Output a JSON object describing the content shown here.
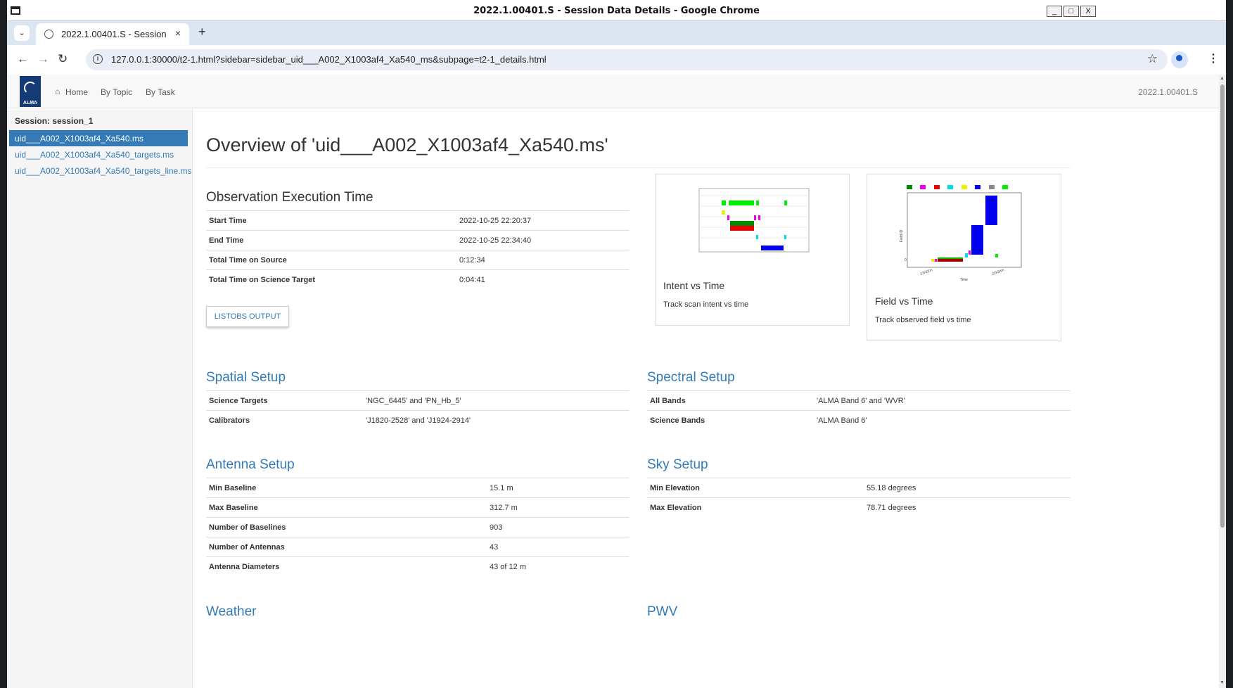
{
  "window": {
    "title": "2022.1.00401.S - Session Data Details - Google Chrome"
  },
  "window_controls": {
    "minimize": "_",
    "maximize": "□",
    "close": "X"
  },
  "tab": {
    "title": "2022.1.00401.S - Session"
  },
  "tabstrip": {
    "new_tab": "+",
    "close_tab": "×",
    "menu": "⌄"
  },
  "toolbar": {
    "url": "127.0.0.1:30000/t2-1.html?sidebar=sidebar_uid___A002_X1003af4_Xa540_ms&subpage=t2-1_details.html",
    "back": "←",
    "forward": "→",
    "reload": "↻",
    "bookmark": "☆",
    "menu": "⋮",
    "info": "i"
  },
  "topnav": {
    "logo_text": "ALMA",
    "home_icon": "⌂",
    "home": "Home",
    "by_topic": "By Topic",
    "by_task": "By Task",
    "project_code": "2022.1.00401.S"
  },
  "sidebar": {
    "header": "Session: session_1",
    "items": [
      {
        "label": "uid___A002_X1003af4_Xa540.ms",
        "active": true
      },
      {
        "label": "uid___A002_X1003af4_Xa540_targets.ms",
        "active": false
      },
      {
        "label": "uid___A002_X1003af4_Xa540_targets_line.ms",
        "active": false
      }
    ]
  },
  "main": {
    "title": "Overview of 'uid___A002_X1003af4_Xa540.ms'",
    "observation": {
      "title": "Observation Execution Time",
      "rows": [
        {
          "key": "Start Time",
          "value": "2022-10-25 22:20:37"
        },
        {
          "key": "End Time",
          "value": "2022-10-25 22:34:40"
        },
        {
          "key": "Total Time on Source",
          "value": "0:12:34"
        },
        {
          "key": "Total Time on Science Target",
          "value": "0:04:41"
        }
      ],
      "button": "LISTOBS OUTPUT"
    },
    "cards": [
      {
        "title": "Intent vs Time",
        "desc": "Track scan intent vs time"
      },
      {
        "title": "Field vs Time",
        "desc": "Track observed field vs time"
      }
    ],
    "plot_labels": {
      "field_ylabel": "Field ID",
      "time_xlabel": "Time",
      "zero": "0",
      "tick_left": "22h22m",
      "tick_right": "22h34m"
    },
    "spatial": {
      "title": "Spatial Setup",
      "rows": [
        {
          "key": "Science Targets",
          "value": "'NGC_6445' and 'PN_Hb_5'"
        },
        {
          "key": "Calibrators",
          "value": "'J1820-2528' and 'J1924-2914'"
        }
      ]
    },
    "spectral": {
      "title": "Spectral Setup",
      "rows": [
        {
          "key": "All Bands",
          "value": "'ALMA Band 6' and 'WVR'"
        },
        {
          "key": "Science Bands",
          "value": "'ALMA Band 6'"
        }
      ]
    },
    "antenna": {
      "title": "Antenna Setup",
      "rows": [
        {
          "key": "Min Baseline",
          "value": "15.1 m"
        },
        {
          "key": "Max Baseline",
          "value": "312.7 m"
        },
        {
          "key": "Number of Baselines",
          "value": "903"
        },
        {
          "key": "Number of Antennas",
          "value": "43"
        },
        {
          "key": "Antenna Diameters",
          "value": "43 of 12 m"
        }
      ]
    },
    "sky": {
      "title": "Sky Setup",
      "rows": [
        {
          "key": "Min Elevation",
          "value": "55.18 degrees"
        },
        {
          "key": "Max Elevation",
          "value": "78.71 degrees"
        }
      ]
    },
    "weather": {
      "title": "Weather"
    },
    "pwv": {
      "title": "PWV"
    }
  },
  "colors": {
    "link": "#337ab7",
    "active_bg": "#337ab7",
    "logo_bg": "#153a75"
  }
}
